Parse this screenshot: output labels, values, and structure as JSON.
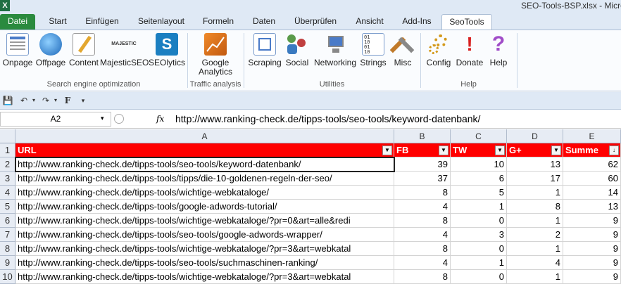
{
  "window": {
    "title": "SEO-Tools-BSP.xlsx  -  Micro",
    "logo": "X"
  },
  "tabs": [
    {
      "label": "Datei"
    },
    {
      "label": "Start"
    },
    {
      "label": "Einfügen"
    },
    {
      "label": "Seitenlayout"
    },
    {
      "label": "Formeln"
    },
    {
      "label": "Daten"
    },
    {
      "label": "Überprüfen"
    },
    {
      "label": "Ansicht"
    },
    {
      "label": "Add-Ins"
    },
    {
      "label": "SeoTools"
    }
  ],
  "ribbon": {
    "buttons": [
      {
        "label": "Onpage",
        "icon": "onpage-icon"
      },
      {
        "label": "Offpage",
        "icon": "offpage-icon"
      },
      {
        "label": "Content",
        "icon": "content-icon"
      },
      {
        "label": "MajesticSEO",
        "icon": "majestic-icon",
        "icon_text": "MAJESTIC"
      },
      {
        "label": "SEOlytics",
        "icon": "seolytics-icon",
        "icon_text": "S"
      },
      {
        "label": "Google\nAnalytics",
        "line1": "Google",
        "line2": "Analytics",
        "icon": "analytics-icon"
      },
      {
        "label": "Scraping",
        "icon": "scraping-icon"
      },
      {
        "label": "Social",
        "icon": "social-icon"
      },
      {
        "label": "Networking",
        "icon": "networking-icon"
      },
      {
        "label": "Strings",
        "icon": "strings-icon"
      },
      {
        "label": "Misc",
        "icon": "misc-icon"
      },
      {
        "label": "Config",
        "icon": "config-icon"
      },
      {
        "label": "Donate",
        "icon": "donate-icon",
        "icon_text": "!"
      },
      {
        "label": "Help",
        "icon": "help-icon",
        "icon_text": "?"
      }
    ],
    "groups": [
      {
        "label": "Search engine optimization"
      },
      {
        "label": "Traffic analysis"
      },
      {
        "label": "Utilities"
      },
      {
        "label": "Help"
      }
    ]
  },
  "qat": {
    "save": "💾",
    "undo": "↶",
    "redo": "↷",
    "bold": "F",
    "more": "▾"
  },
  "formula_bar": {
    "name_box": "A2",
    "fx": "fx",
    "formula": "http://www.ranking-check.de/tipps-tools/seo-tools/keyword-datenbank/"
  },
  "columns": [
    "A",
    "B",
    "C",
    "D",
    "E"
  ],
  "header_row": [
    "URL",
    "FB",
    "TW",
    "G+",
    "Summe"
  ],
  "rows": [
    {
      "n": "2",
      "url": "http://www.ranking-check.de/tipps-tools/seo-tools/keyword-datenbank/",
      "fb": "39",
      "tw": "10",
      "gp": "13",
      "sum": "62"
    },
    {
      "n": "3",
      "url": "http://www.ranking-check.de/tipps-tools/tipps/die-10-goldenen-regeln-der-seo/",
      "fb": "37",
      "tw": "6",
      "gp": "17",
      "sum": "60"
    },
    {
      "n": "4",
      "url": "http://www.ranking-check.de/tipps-tools/wichtige-webkataloge/",
      "fb": "8",
      "tw": "5",
      "gp": "1",
      "sum": "14"
    },
    {
      "n": "5",
      "url": "http://www.ranking-check.de/tipps-tools/google-adwords-tutorial/",
      "fb": "4",
      "tw": "1",
      "gp": "8",
      "sum": "13"
    },
    {
      "n": "6",
      "url": "http://www.ranking-check.de/tipps-tools/wichtige-webkataloge/?pr=0&art=alle&redi",
      "fb": "8",
      "tw": "0",
      "gp": "1",
      "sum": "9"
    },
    {
      "n": "7",
      "url": "http://www.ranking-check.de/tipps-tools/seo-tools/google-adwords-wrapper/",
      "fb": "4",
      "tw": "3",
      "gp": "2",
      "sum": "9"
    },
    {
      "n": "8",
      "url": "http://www.ranking-check.de/tipps-tools/wichtige-webkataloge/?pr=3&art=webkatal",
      "fb": "8",
      "tw": "0",
      "gp": "1",
      "sum": "9"
    },
    {
      "n": "9",
      "url": "http://www.ranking-check.de/tipps-tools/seo-tools/suchmaschinen-ranking/",
      "fb": "4",
      "tw": "1",
      "gp": "4",
      "sum": "9"
    },
    {
      "n": "10",
      "url": "http://www.ranking-check.de/tipps-tools/wichtige-webkataloge/?pr=3&art=webkatal",
      "fb": "8",
      "tw": "0",
      "gp": "1",
      "sum": "9"
    }
  ],
  "colors": {
    "header_fill": "#ff0000",
    "header_text": "#ffffff",
    "file_tab": "#2a8a3e"
  }
}
